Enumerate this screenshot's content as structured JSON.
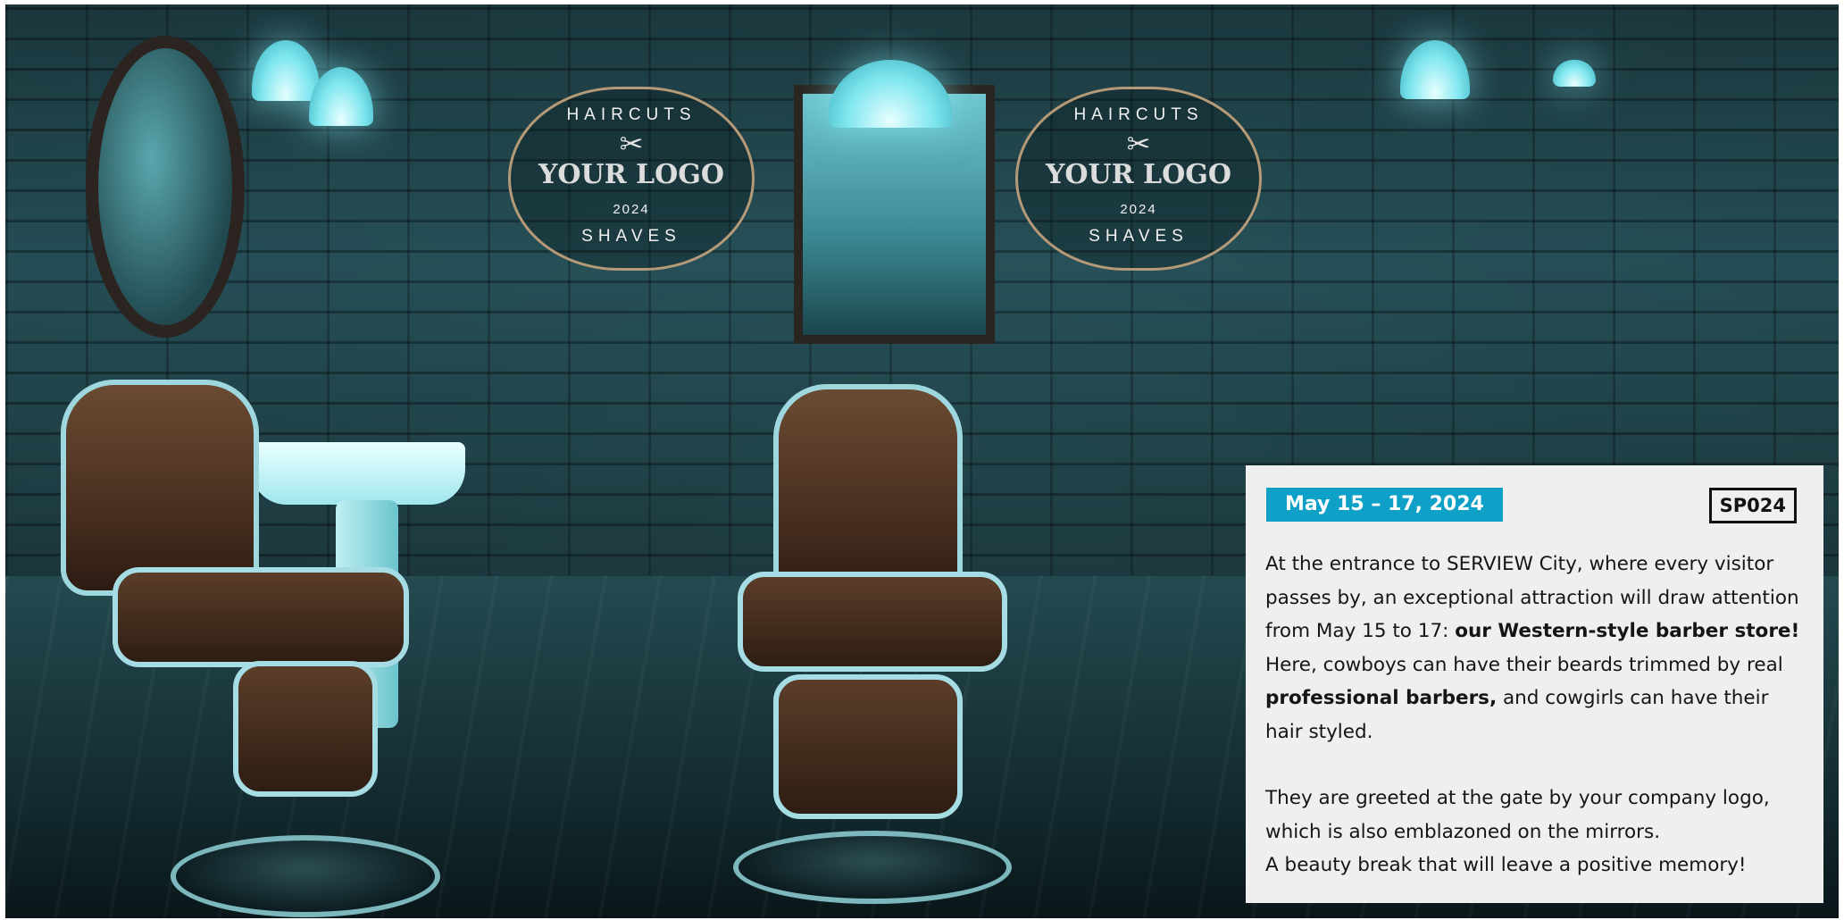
{
  "logo": {
    "top_text": "HAIRCUTS",
    "name": "YOUR LOGO",
    "year": "2024",
    "bottom_text": "SHAVES"
  },
  "info_panel": {
    "date_range": "May 15 – 17, 2024",
    "code": "SP024",
    "paragraph_1": {
      "t1": "At the entrance to SERVIEW City, where every visitor passes by, an exceptional attraction will draw attention from May 15 to 17: ",
      "b1": "our Western-style barber store!",
      "t2": " Here, cowboys can have their beards trimmed by real ",
      "b2": "professional barbers,",
      "t3": " and cowgirls can have their hair styled."
    },
    "paragraph_2": "They are greeted at the gate by your company logo, which is also emblazoned on the mirrors.",
    "paragraph_3": "A beauty break that will leave a positive memory!"
  },
  "colors": {
    "accent": "#0fa0c8",
    "panel_bg": "#efefef",
    "text": "#151515"
  }
}
